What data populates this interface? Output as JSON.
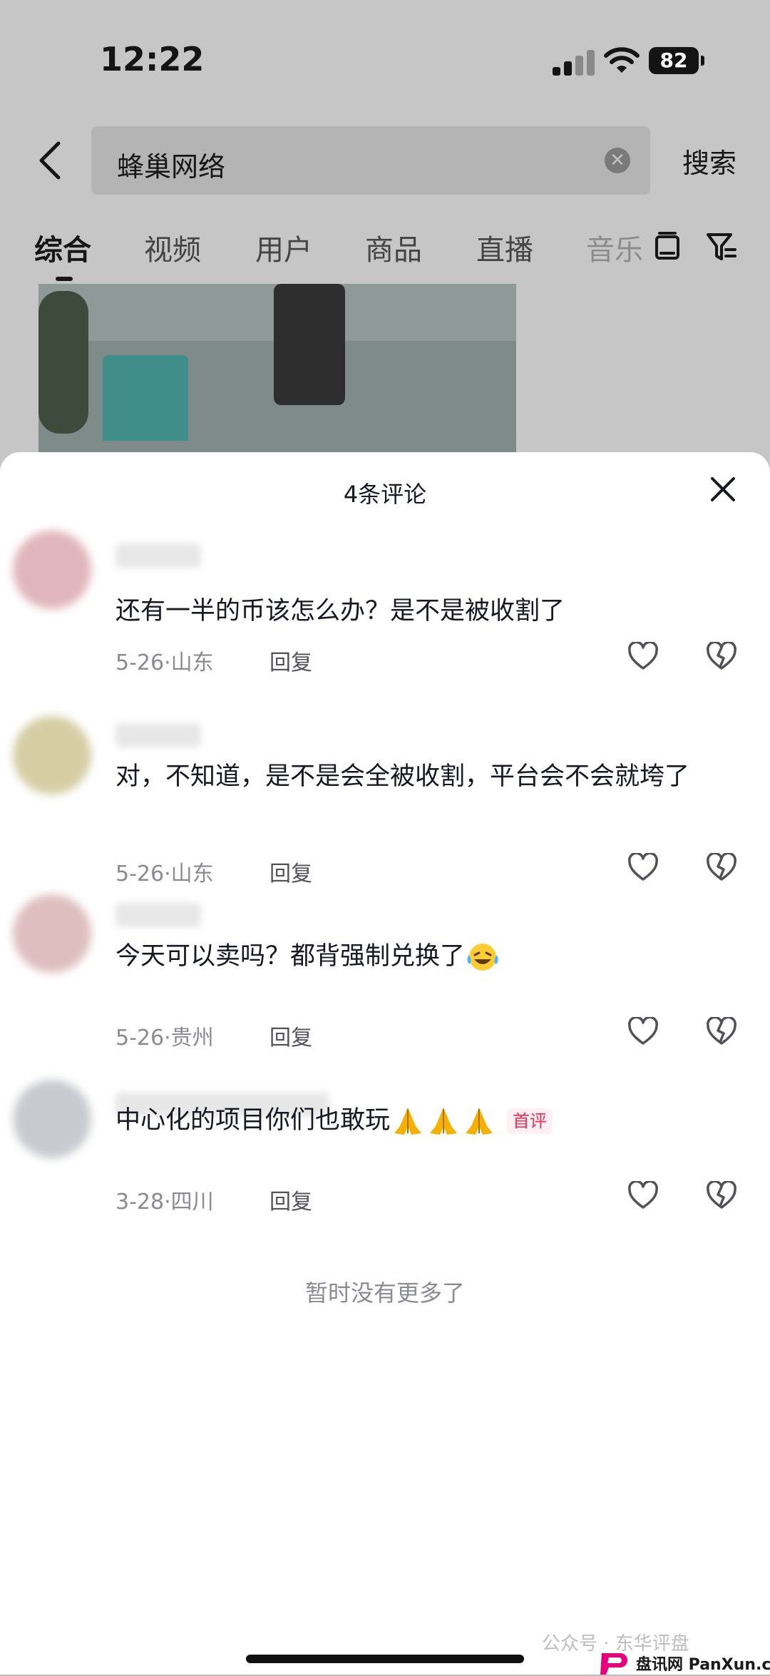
{
  "status_bar": {
    "time": "12:22",
    "battery": "82"
  },
  "search": {
    "query": "蜂巢网络",
    "submit_label": "搜索"
  },
  "tabs": [
    {
      "label": "综合",
      "active": true
    },
    {
      "label": "视频"
    },
    {
      "label": "用户"
    },
    {
      "label": "商品"
    },
    {
      "label": "直播"
    },
    {
      "label": "音乐"
    }
  ],
  "comments_sheet": {
    "title": "4条评论",
    "comments": [
      {
        "text": "还有一半的币该怎么办？是不是被收割了",
        "meta": "5-26·山东",
        "reply": "回复"
      },
      {
        "text": "对，不知道，是不是会全被收割，平台会不会就垮了",
        "meta": "5-26·山东",
        "reply": "回复"
      },
      {
        "text": "今天可以卖吗？都背强制兑换了",
        "meta": "5-26·贵州",
        "reply": "回复",
        "emoji": "laughing-tears"
      },
      {
        "text": "中心化的项目你们也敢玩",
        "meta": "3-28·四川",
        "reply": "回复",
        "emoji": "praying-hands",
        "emoji_count": 3,
        "badge": "首评"
      }
    ],
    "footer": "暂时没有更多了"
  },
  "watermark": {
    "text": "公众号 · 东华评盘",
    "site": "盘讯网 PanXun.cc"
  },
  "colors": {
    "badge": "#fe2c55",
    "meta": "#8a8b91"
  }
}
